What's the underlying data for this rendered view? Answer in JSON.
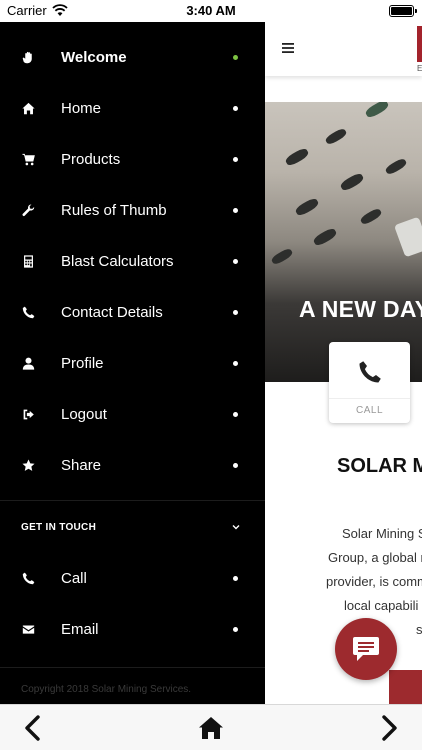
{
  "status_bar": {
    "carrier": "Carrier",
    "time": "3:40 AM"
  },
  "drawer": {
    "items": [
      {
        "label": "Welcome",
        "icon": "hand-icon",
        "active": true
      },
      {
        "label": "Home",
        "icon": "home-icon"
      },
      {
        "label": "Products",
        "icon": "cart-icon"
      },
      {
        "label": "Rules of Thumb",
        "icon": "wrench-icon"
      },
      {
        "label": "Blast Calculators",
        "icon": "calculator-icon"
      },
      {
        "label": "Contact Details",
        "icon": "phone-icon"
      },
      {
        "label": "Profile",
        "icon": "user-icon"
      },
      {
        "label": "Logout",
        "icon": "logout-icon"
      },
      {
        "label": "Share",
        "icon": "star-icon"
      }
    ],
    "section_title": "GET IN TOUCH",
    "section_items": [
      {
        "label": "Call",
        "icon": "phone-icon"
      },
      {
        "label": "Email",
        "icon": "envelope-icon"
      }
    ],
    "copyright": "Copyright 2018 Solar Mining Services."
  },
  "header": {
    "logo_text": "E"
  },
  "hero": {
    "title": "A NEW DAY"
  },
  "call_card": {
    "label": "CALL"
  },
  "about": {
    "heading": "SOLAR M",
    "lines": [
      "Solar Mining S",
      "Group, a global r",
      "provider, is comm",
      "local capabili",
      "s"
    ]
  },
  "colors": {
    "accent": "#9d2a2e",
    "active_dot": "#7dc242",
    "drawer_bg": "#000000"
  },
  "bottom_toolbar": {
    "back_icon": "chevron-left-icon",
    "home_icon": "home-icon",
    "forward_icon": "chevron-right-icon"
  }
}
